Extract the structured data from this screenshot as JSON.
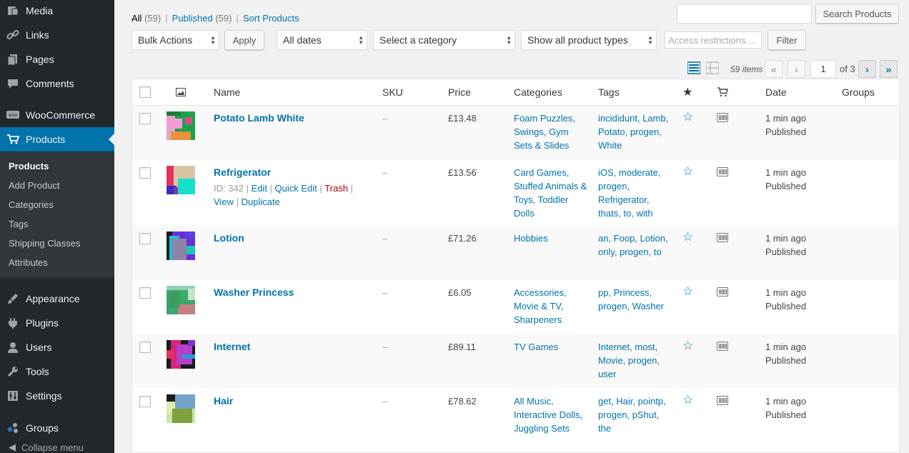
{
  "sidebar": {
    "items": [
      {
        "label": "Media",
        "icon": "media-icon"
      },
      {
        "label": "Links",
        "icon": "links-icon"
      },
      {
        "label": "Pages",
        "icon": "pages-icon"
      },
      {
        "label": "Comments",
        "icon": "comments-icon"
      },
      {
        "label": "WooCommerce",
        "icon": "woocommerce-icon"
      },
      {
        "label": "Products",
        "icon": "products-icon"
      },
      {
        "label": "Appearance",
        "icon": "appearance-icon"
      },
      {
        "label": "Plugins",
        "icon": "plugins-icon"
      },
      {
        "label": "Users",
        "icon": "users-icon"
      },
      {
        "label": "Tools",
        "icon": "tools-icon"
      },
      {
        "label": "Settings",
        "icon": "settings-icon"
      },
      {
        "label": "Groups",
        "icon": "groups-icon"
      }
    ],
    "submenu": [
      "Products",
      "Add Product",
      "Categories",
      "Tags",
      "Shipping Classes",
      "Attributes"
    ],
    "collapse_label": "Collapse menu"
  },
  "views": {
    "all": "All",
    "all_count": "(59)",
    "published": "Published",
    "published_count": "(59)",
    "sort": "Sort Products"
  },
  "search": {
    "value": "",
    "button": "Search Products"
  },
  "filters": {
    "bulk_actions": "Bulk Actions",
    "apply": "Apply",
    "dates": "All dates",
    "category": "Select a category",
    "product_types": "Show all product types",
    "access_placeholder": "Access restrictions ...",
    "filter_button": "Filter"
  },
  "pagination": {
    "items": "59 items",
    "current_page": "1",
    "of_pages": "of 3",
    "first": "«",
    "prev": "‹",
    "next": "›",
    "last": "»"
  },
  "columns": {
    "name": "Name",
    "sku": "SKU",
    "price": "Price",
    "categories": "Categories",
    "tags": "Tags",
    "date": "Date",
    "groups": "Groups"
  },
  "products": [
    {
      "name": "Potato Lamb White",
      "sku": "–",
      "price": "£13.48",
      "categories": "Foam Puzzles, Swings, Gym Sets & Slides",
      "tags": "incididunt, Lamb, Potato, progen, White",
      "date": "1 min ago",
      "status": "Published"
    },
    {
      "name": "Refrigerator",
      "sku": "–",
      "price": "£13.56",
      "categories": "Card Games, Stuffed Animals & Toys, Toddler Dolls",
      "tags": "iOS, moderate, progen, Refrigerator, thats, to, with",
      "date": "1 min ago",
      "status": "Published",
      "row_actions": {
        "id": "ID: 342",
        "edit": "Edit",
        "quick_edit": "Quick Edit",
        "trash": "Trash",
        "view": "View",
        "duplicate": "Duplicate"
      }
    },
    {
      "name": "Lotion",
      "sku": "–",
      "price": "£71.26",
      "categories": "Hobbies",
      "tags": "an, Foop, Lotion, only, progen, to",
      "date": "1 min ago",
      "status": "Published"
    },
    {
      "name": "Washer Princess",
      "sku": "–",
      "price": "£6.05",
      "categories": "Accessories, Movie & TV, Sharpeners",
      "tags": "pp, Princess, progen, Washer",
      "date": "1 min ago",
      "status": "Published"
    },
    {
      "name": "Internet",
      "sku": "–",
      "price": "£89.11",
      "categories": "TV Games",
      "tags": "Internet, most, Movie, progen, user",
      "date": "1 min ago",
      "status": "Published"
    },
    {
      "name": "Hair",
      "sku": "–",
      "price": "£78.62",
      "categories": "All Music, Interactive Dolls, Juggling Sets",
      "tags": "get, Hair, pointp, progen, pShut, the",
      "date": "1 min ago",
      "status": "Published"
    }
  ],
  "colors": {
    "sidebar_bg": "#23282d",
    "active": "#0073aa",
    "link": "#0073aa",
    "trash": "#aa0000"
  }
}
